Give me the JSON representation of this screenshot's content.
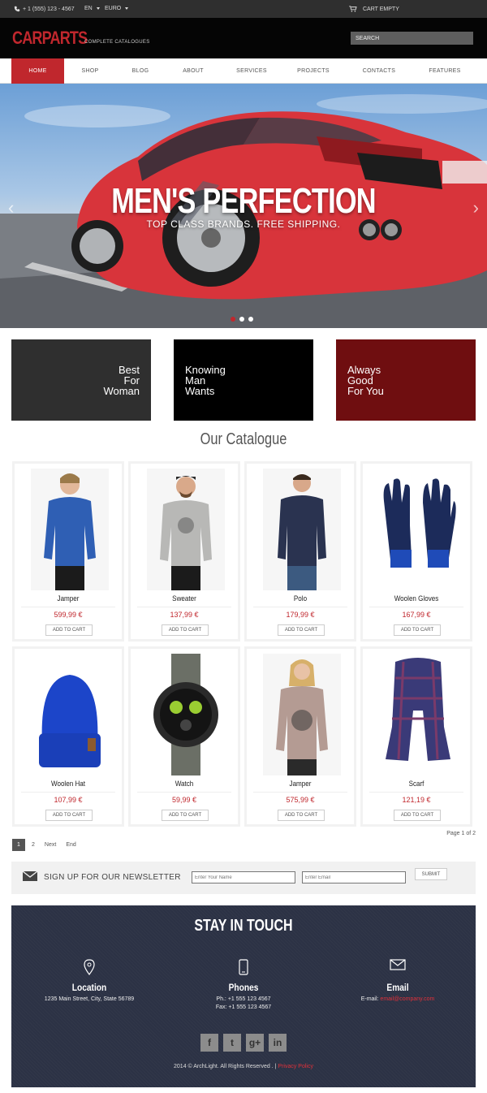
{
  "topbar": {
    "phone": "+ 1 (555) 123 - 4567",
    "language": "EN",
    "currency": "EURO",
    "cart": "CART EMPTY"
  },
  "header": {
    "logo": "CARPARTS",
    "tagline": "COMPLETE CATALOGUES",
    "search_placeholder": "SEARCH"
  },
  "nav": [
    "HOME",
    "SHOP",
    "BLOG",
    "ABOUT",
    "SERVICES",
    "PROJECTS",
    "CONTACTS",
    "FEATURES"
  ],
  "hero": {
    "title": "MEN'S PERFECTION",
    "subtitle": "TOP CLASS BRANDS. FREE SHIPPING.",
    "active_slide": 1,
    "slide_count": 3
  },
  "promos": [
    {
      "lines": [
        "Best",
        "For",
        "Woman"
      ],
      "color": "#2f2f2f",
      "align": "right"
    },
    {
      "lines": [
        "Knowing",
        "Man",
        "Wants"
      ],
      "color": "#000000",
      "align": "left"
    },
    {
      "lines": [
        "Always",
        "Good",
        "For You"
      ],
      "color": "#6f0e10",
      "align": "left"
    }
  ],
  "catalogue": {
    "title": "Our Catalogue",
    "button_label": "ADD TO CART",
    "products": [
      {
        "name": "Jamper",
        "price": "599,99 €",
        "icon": "blue-sweater-man"
      },
      {
        "name": "Sweater",
        "price": "137,99 €",
        "icon": "grey-sweater-man"
      },
      {
        "name": "Polo",
        "price": "179,99 €",
        "icon": "navy-polo-man"
      },
      {
        "name": "Woolen Gloves",
        "price": "167,99 €",
        "icon": "gloves"
      },
      {
        "name": "Woolen Hat",
        "price": "107,99 €",
        "icon": "beanie-hat"
      },
      {
        "name": "Watch",
        "price": "59,99 €",
        "icon": "wrist-watch"
      },
      {
        "name": "Jamper",
        "price": "575,99 €",
        "icon": "woman-sweater"
      },
      {
        "name": "Scarf",
        "price": "121,19 €",
        "icon": "plaid-scarf"
      }
    ]
  },
  "pagination": {
    "info": "Page 1 of 2",
    "current": "1",
    "next_page": "2",
    "next": "Next",
    "end": "End"
  },
  "newsletter": {
    "label": "SIGN UP FOR OUR NEWSLETTER",
    "name_placeholder": "Enter Your Name",
    "email_placeholder": "Enter Email",
    "submit": "SUBMIT"
  },
  "footer": {
    "title": "STAY IN TOUCH",
    "location": {
      "head": "Location",
      "text": "1235 Main Street, City, State 56789"
    },
    "phones": {
      "head": "Phones",
      "line1": "Ph.: +1 555 123 4567",
      "line2": "Fax: +1 555 123 4567"
    },
    "email": {
      "head": "Email",
      "prefix": "E-mail:",
      "address": "email@company.com"
    },
    "socials": [
      "f",
      "t",
      "g+",
      "in"
    ],
    "copyright": "2014 © ArchLight. All Rights Reserved .",
    "privacy": "Privacy Policy"
  },
  "colors": {
    "accent": "#c0272d",
    "header_bg": "#050505",
    "footer_bg": "#2c3245"
  }
}
